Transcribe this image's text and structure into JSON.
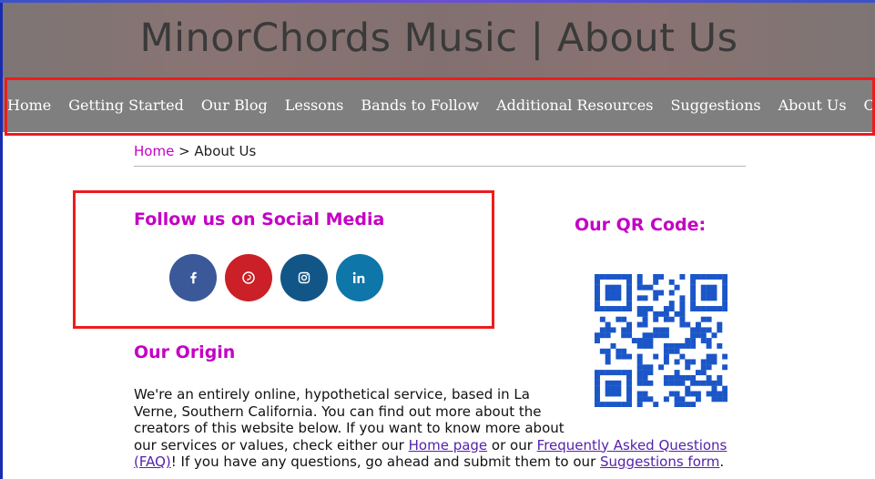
{
  "header": {
    "title": "MinorChords Music | About Us"
  },
  "nav": {
    "items": [
      "Home",
      "Getting Started",
      "Our Blog",
      "Lessons",
      "Bands to Follow",
      "Additional Resources",
      "Suggestions",
      "About Us",
      "Contact Us"
    ]
  },
  "breadcrumb": {
    "home": "Home",
    "separator": " > ",
    "current": "About Us"
  },
  "social": {
    "title": "Follow us on Social Media",
    "buttons": [
      {
        "name": "facebook",
        "glyph": "f",
        "color": "#3b5998"
      },
      {
        "name": "pinterest",
        "glyph": "p",
        "color": "#cb2027"
      },
      {
        "name": "instagram",
        "glyph": "ig",
        "color": "#125688"
      },
      {
        "name": "linkedin",
        "glyph": "in",
        "color": "#0e76a8"
      }
    ]
  },
  "qr": {
    "title": "Our QR Code:",
    "color": "#1a56c8"
  },
  "origin": {
    "title": "Our Origin",
    "line1": "We're an entirely online, hypothetical service, based in La",
    "line2": "Verne, Southern California. You can find out more about the",
    "line3": "creators of this website below. If you want to know more about",
    "line4_pre": "our services or values, check either our ",
    "home_link": "Home page",
    "line4_mid": " or our ",
    "faq_link_a": "Frequently Asked Questions",
    "faq_link_b": "(FAQ)",
    "line5_mid": "! If you have any questions, go ahead and submit them to our ",
    "suggestions_link": "Suggestions form",
    "line5_end": "."
  },
  "colors": {
    "accent": "#c400c4",
    "highlight": "#ee1c1c",
    "nav_bg": "#7f7f7f"
  }
}
